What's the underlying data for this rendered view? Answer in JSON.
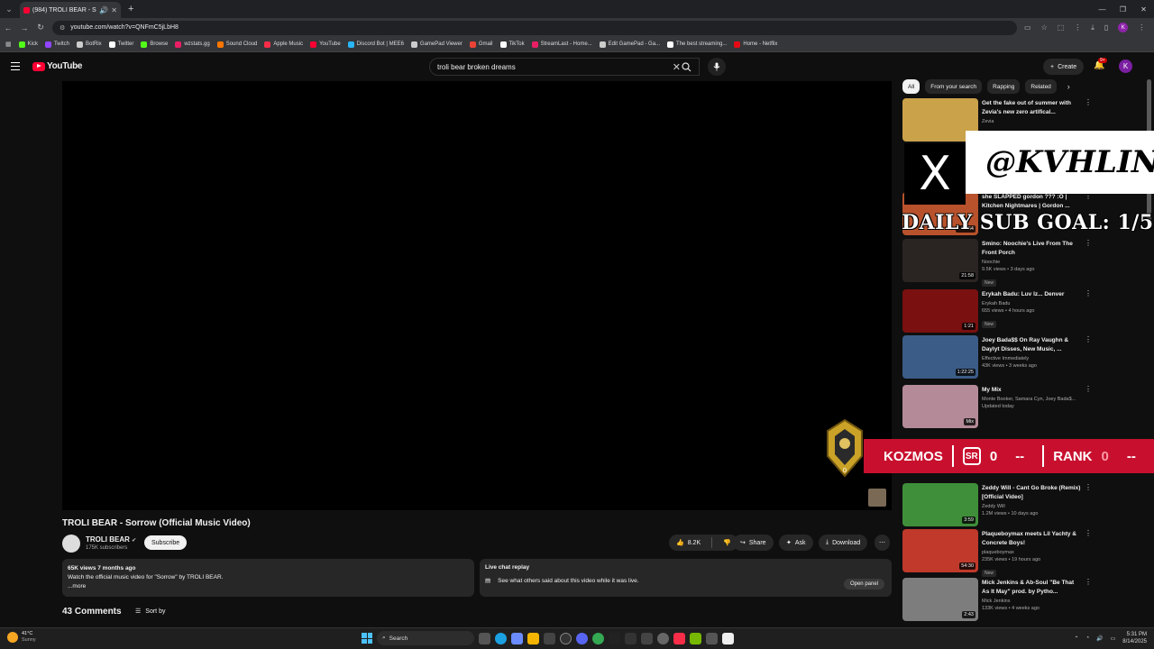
{
  "browser": {
    "tab_title": "(984) TROLI BEAR - Sorrow",
    "url": "youtube.com/watch?v=QNFmC5jLbH8",
    "profile_initial": "K",
    "bookmarks": [
      {
        "label": "Kick",
        "color": "#53fc18"
      },
      {
        "label": "Twitch",
        "color": "#9146ff"
      },
      {
        "label": "BotRix",
        "color": "#cccccc"
      },
      {
        "label": "Twitter",
        "color": "#ffffff"
      },
      {
        "label": "Browse",
        "color": "#53fc18"
      },
      {
        "label": "wzstats.gg",
        "color": "#e91e63"
      },
      {
        "label": "Sound Cloud",
        "color": "#ff7700"
      },
      {
        "label": "Apple Music",
        "color": "#fa2d48"
      },
      {
        "label": "YouTube",
        "color": "#ff0033"
      },
      {
        "label": "Discord Bot | MEE6",
        "color": "#29b6f6"
      },
      {
        "label": "GamePad Viewer",
        "color": "#cccccc"
      },
      {
        "label": "Gmail",
        "color": "#ea4335"
      },
      {
        "label": "TikTok",
        "color": "#ffffff"
      },
      {
        "label": "StreamLast - Home...",
        "color": "#e91e63"
      },
      {
        "label": "Edit GamePad - Ga...",
        "color": "#cccccc"
      },
      {
        "label": "The best streaming...",
        "color": "#ffffff"
      },
      {
        "label": "Home - Netflix",
        "color": "#e50914"
      }
    ]
  },
  "youtube": {
    "logo_text": "YouTube",
    "search_query": "troli bear broken dreams",
    "create_label": "Create",
    "notif_count": "9+",
    "avatar_initial": "K"
  },
  "video": {
    "title": "TROLI BEAR - Sorrow (Official Music Video)",
    "channel": "TROLI BEAR",
    "subscribers": "175K subscribers",
    "subscribe_label": "Subscribe",
    "likes": "8.2K",
    "share_label": "Share",
    "ask_label": "Ask",
    "download_label": "Download",
    "views_meta": "65K views  7 months ago",
    "description": "Watch the official music video for \"Sorrow\" by TROLI BEAR.",
    "more_label": "...more",
    "live_chat_title": "Live chat replay",
    "live_chat_text": "See what others said about this video while it was live.",
    "open_panel_label": "Open panel",
    "comments_count": "43 Comments",
    "sort_label": "Sort by"
  },
  "sidebar": {
    "chips": [
      "All",
      "From your search",
      "Rapping",
      "Related"
    ],
    "recs": [
      {
        "title": "Get the fake out of summer with Zevia's new zero artifical...",
        "channel": "Zevia",
        "views": "",
        "duration": "",
        "new": false,
        "thumb": "#c9a24a"
      },
      {
        "title": "she SLAPPED gordon ??? :O | Kitchen Nightmares | Gordon ...",
        "channel": "",
        "views": "",
        "duration": "1:25:54",
        "new": false,
        "thumb": "#b8522c"
      },
      {
        "title": "Smino: Noochie's Live From The Front Porch",
        "channel": "Noochie",
        "views": "9.5K views • 3 days ago",
        "duration": "21:58",
        "new": true,
        "thumb": "#2a2523"
      },
      {
        "title": "Erykah Badu: Luv Iz... Denver",
        "channel": "Erykah Badu",
        "views": "655 views • 4 hours ago",
        "duration": "1:21",
        "new": true,
        "thumb": "#7a1010"
      },
      {
        "title": "Joey Bada$$ On Ray Vaughn & Daylyt Disses, New Music, ...",
        "channel": "Effective Immediately",
        "views": "43K views • 3 weeks ago",
        "duration": "1:22:25",
        "new": false,
        "thumb": "#3b5c86"
      },
      {
        "title": "My Mix",
        "channel": "Monte Booker, Samara Cyn, Joey Bada$...",
        "views": "Updated today",
        "duration": "Mix",
        "new": false,
        "thumb": "#b48a98"
      },
      {
        "title": "Zeddy Will - Cant Go Broke (Remix) [Official Video]",
        "channel": "Zeddy Will",
        "views": "1.2M views • 10 days ago",
        "duration": "3:59",
        "new": false,
        "thumb": "#3f8f3a"
      },
      {
        "title": "Plaqueboymax meets Lil Yachty & Concrete Boys!",
        "channel": "plaqueboymax",
        "views": "235K views • 19 hours ago",
        "duration": "54:30",
        "new": true,
        "thumb": "#c0392b"
      },
      {
        "title": "Mick Jenkins & Ab-Soul \"Be That As It May\" prod. by Pytho...",
        "channel": "Mick Jenkins",
        "views": "133K views • 4 weeks ago",
        "duration": "2:43",
        "new": false,
        "thumb": "#7d7d7d"
      }
    ]
  },
  "overlays": {
    "x_glyph": "X",
    "handle": "@KVHLIN",
    "sub_goal": "DAILY SUB GOAL: 1/5",
    "rank_name": "KOZMOS",
    "sr_label": "SR",
    "sr_value": "0",
    "dash1": "--",
    "rank_label": "RANK",
    "rank_value": "0",
    "dash2": "--",
    "crest_value": "0"
  },
  "taskbar": {
    "temp": "41°C",
    "condition": "Sunny",
    "search_label": "Search",
    "time": "5:31 PM",
    "date": "8/14/2025"
  }
}
